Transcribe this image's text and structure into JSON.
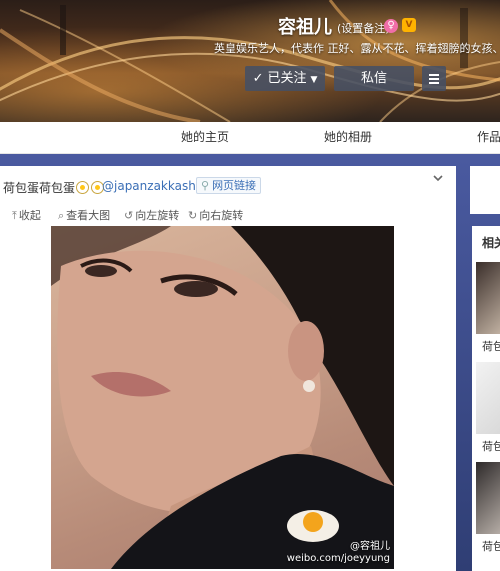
{
  "profile": {
    "name": "容祖儿",
    "remark": "(设置备注)",
    "bio": "英皇娱乐艺人，代表作 正好、露从不花、挥着翅膀的女孩、小小",
    "follow_button": "已关注",
    "message_button": "私信"
  },
  "nav": {
    "tabs": [
      "她的主页",
      "她的相册",
      "作品"
    ]
  },
  "post": {
    "title": "荷包蛋荷包蛋",
    "mention": "@japanzakkashop",
    "web_link": "网页链接"
  },
  "toolbar": {
    "collapse": "收起",
    "view_large": "查看大图",
    "rotate_left": "向左旋转",
    "rotate_right": "向右旋转"
  },
  "photo": {
    "watermark_user": "@容祖儿",
    "watermark_url": "weibo.com/joeyyung"
  },
  "sidebar": {
    "heading": "相关",
    "captions": [
      "荷包",
      "荷包",
      "荷包"
    ]
  },
  "colors": {
    "link": "#3b6fb6",
    "button_bg": "#465064",
    "accent_gender": "#f06ea8"
  },
  "icons": [
    "check-icon",
    "caret-down-icon",
    "menu-icon",
    "upload-icon",
    "search-icon",
    "rotate-left-icon",
    "rotate-right-icon",
    "link-icon",
    "chevron-down-icon",
    "egg-emoji-icon"
  ]
}
